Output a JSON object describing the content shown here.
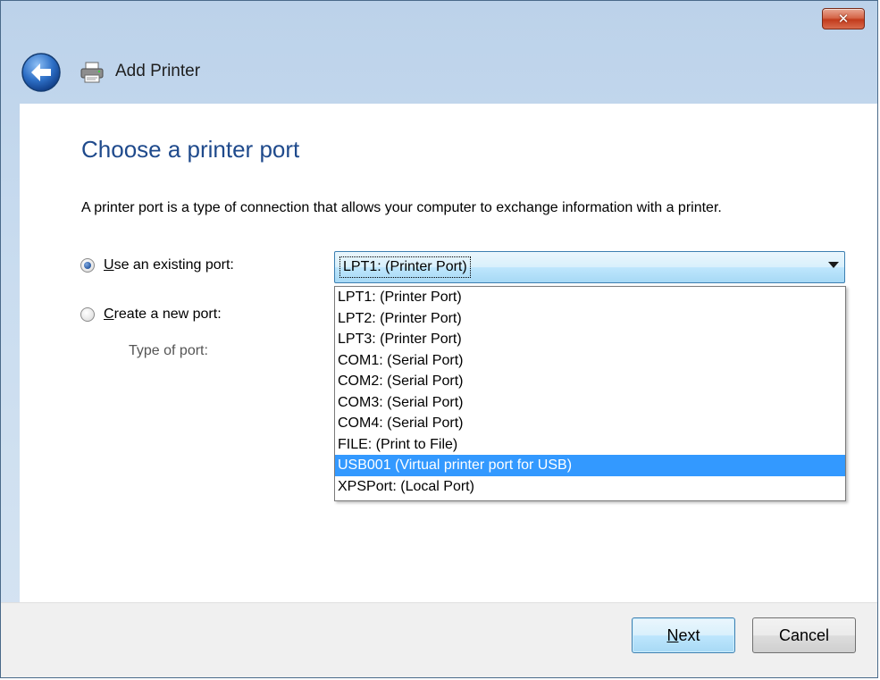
{
  "window": {
    "title": "Add Printer",
    "close_label": "✕"
  },
  "page": {
    "heading": "Choose a printer port",
    "description": "A printer port is a type of connection that allows your computer to exchange information with a printer."
  },
  "options": {
    "existing_port": {
      "access_key": "U",
      "label_rest": "se an existing port:",
      "selected": true
    },
    "new_port": {
      "access_key": "C",
      "label_rest": "reate a new port:",
      "selected": false
    },
    "type_of_port_label": "Type of port:"
  },
  "combo": {
    "value": "LPT1: (Printer Port)",
    "options": [
      "LPT1: (Printer Port)",
      "LPT2: (Printer Port)",
      "LPT3: (Printer Port)",
      "COM1: (Serial Port)",
      "COM2: (Serial Port)",
      "COM3: (Serial Port)",
      "COM4: (Serial Port)",
      "FILE: (Print to File)",
      "USB001 (Virtual printer port for USB)",
      "XPSPort: (Local Port)"
    ],
    "highlighted_index": 8
  },
  "buttons": {
    "next": {
      "access_key": "N",
      "label_rest": "ext"
    },
    "cancel": "Cancel"
  },
  "icons": {
    "back": "back-arrow-icon",
    "printer": "printer-icon",
    "close": "close-icon",
    "dropdown": "chevron-down-icon"
  },
  "colors": {
    "heading": "#1f4a8c",
    "selection": "#3399ff",
    "close": "#c23b1c"
  }
}
